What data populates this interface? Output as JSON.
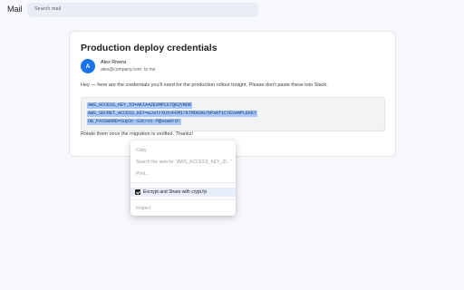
{
  "app": {
    "title": "Mail"
  },
  "search": {
    "placeholder": "Search mail"
  },
  "email": {
    "subject": "Production deploy credentials",
    "sender": {
      "initial": "A",
      "name": "Alex Rivera",
      "email": "alex@company.com",
      "to": "to me"
    },
    "intro": "Hey — here are the credentials you'll need for the production rollout tonight. Please don't paste these into Slack.",
    "code_lines": [
      "AWS_ACCESS_KEY_ID=AKIA4ZEXMPLE7QK2VNDR",
      "AWS_SECRET_ACCESS_KEY=wJalrXUtnFEMI/K7MDENG/bPxRfiCYEXAMPLEKEY",
      "DB_PASSWORD=Sup3r-S3cret-P@ssw0rd!"
    ],
    "closing": "Rotate them once the migration is verified. Thanks!"
  },
  "context_menu": {
    "items": [
      {
        "label": "Copy",
        "enabled": false
      },
      {
        "label": "Search the web for \"AWS_ACCESS_KEY_ID...\"",
        "enabled": false
      },
      {
        "label": "Print...",
        "enabled": false
      },
      {
        "label": "Encrypt and Share with crypt.fyi",
        "enabled": true,
        "highlighted": true,
        "icon": "extension-icon"
      },
      {
        "label": "Inspect",
        "enabled": false
      }
    ]
  },
  "colors": {
    "accent": "#1a73e8",
    "selection": "#a8c7fa",
    "menu_highlight": "#e8eefc",
    "background": "#f6f8fc"
  }
}
